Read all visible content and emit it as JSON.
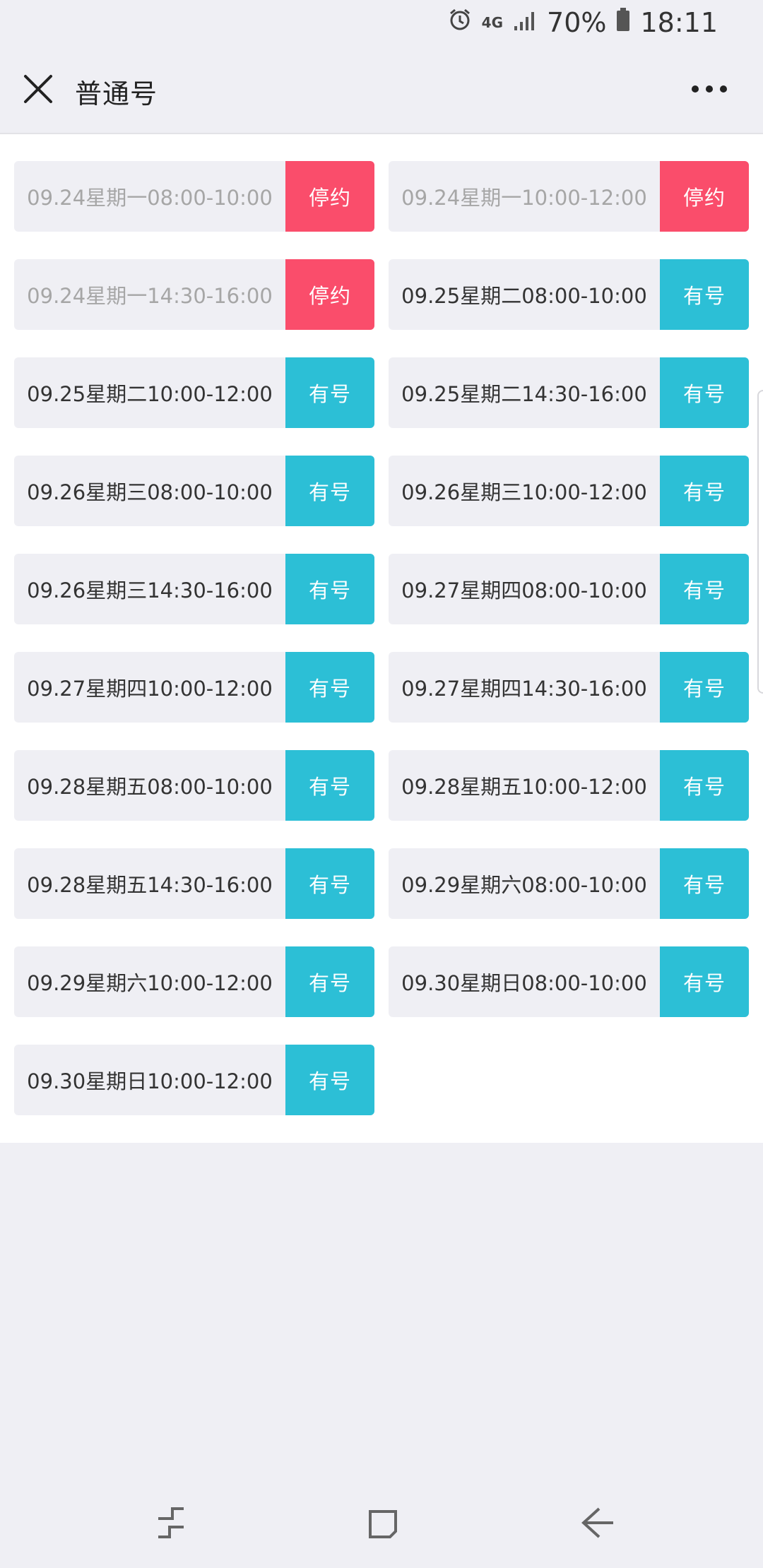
{
  "status_bar": {
    "alarm_icon": "alarm-icon",
    "network": "4G",
    "signal_icon": "signal-icon",
    "battery_percent": "70%",
    "battery_icon": "battery-icon",
    "time": "18:11"
  },
  "nav": {
    "title": "普通号",
    "close_icon": "close-icon",
    "more_icon": "more-icon"
  },
  "colors": {
    "available": "#2cbfd6",
    "stopped": "#fa4d6b",
    "slot_bg": "#efeff4"
  },
  "slots": [
    {
      "time": "09.24星期一08:00-10:00",
      "status": "停约",
      "state": "stopped"
    },
    {
      "time": "09.24星期一10:00-12:00",
      "status": "停约",
      "state": "stopped"
    },
    {
      "time": "09.24星期一14:30-16:00",
      "status": "停约",
      "state": "stopped"
    },
    {
      "time": "09.25星期二08:00-10:00",
      "status": "有号",
      "state": "available"
    },
    {
      "time": "09.25星期二10:00-12:00",
      "status": "有号",
      "state": "available"
    },
    {
      "time": "09.25星期二14:30-16:00",
      "status": "有号",
      "state": "available"
    },
    {
      "time": "09.26星期三08:00-10:00",
      "status": "有号",
      "state": "available"
    },
    {
      "time": "09.26星期三10:00-12:00",
      "status": "有号",
      "state": "available"
    },
    {
      "time": "09.26星期三14:30-16:00",
      "status": "有号",
      "state": "available"
    },
    {
      "time": "09.27星期四08:00-10:00",
      "status": "有号",
      "state": "available"
    },
    {
      "time": "09.27星期四10:00-12:00",
      "status": "有号",
      "state": "available"
    },
    {
      "time": "09.27星期四14:30-16:00",
      "status": "有号",
      "state": "available"
    },
    {
      "time": "09.28星期五08:00-10:00",
      "status": "有号",
      "state": "available"
    },
    {
      "time": "09.28星期五10:00-12:00",
      "status": "有号",
      "state": "available"
    },
    {
      "time": "09.28星期五14:30-16:00",
      "status": "有号",
      "state": "available"
    },
    {
      "time": "09.29星期六08:00-10:00",
      "status": "有号",
      "state": "available"
    },
    {
      "time": "09.29星期六10:00-12:00",
      "status": "有号",
      "state": "available"
    },
    {
      "time": "09.30星期日08:00-10:00",
      "status": "有号",
      "state": "available"
    },
    {
      "time": "09.30星期日10:00-12:00",
      "status": "有号",
      "state": "available"
    }
  ],
  "system_nav": {
    "recents_icon": "recents-icon",
    "home_icon": "home-icon",
    "back_icon": "back-icon"
  }
}
